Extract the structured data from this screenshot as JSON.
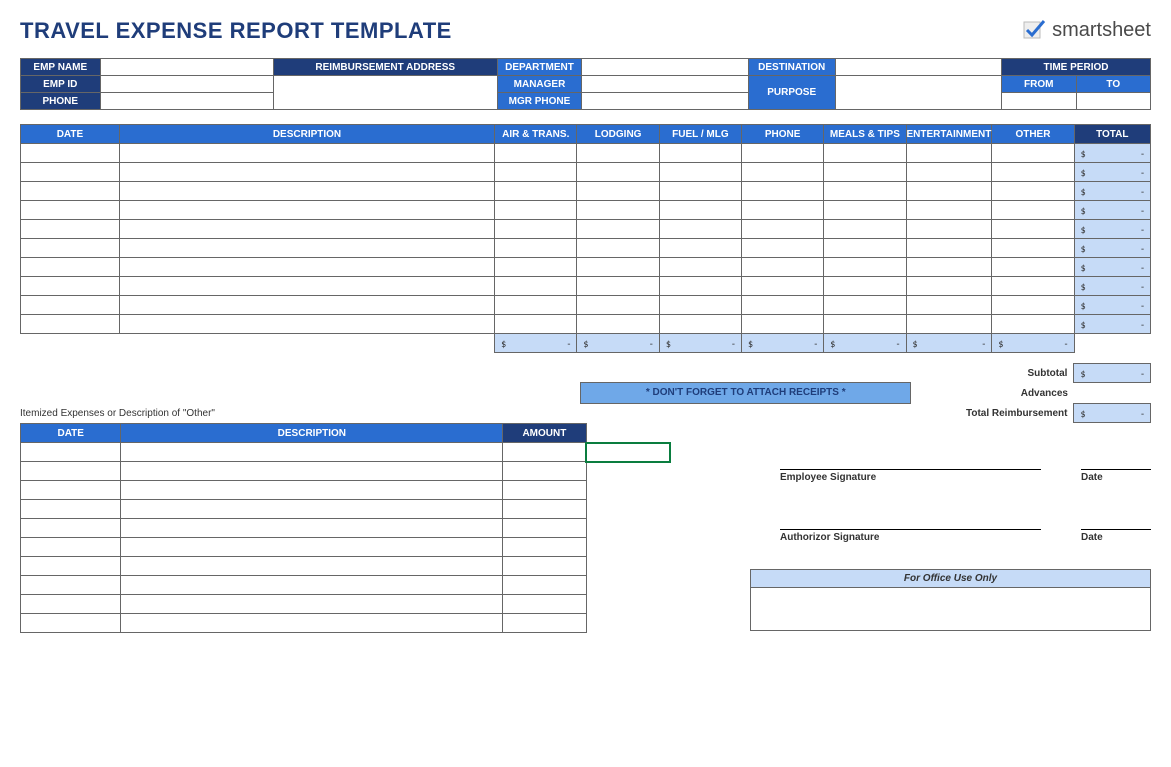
{
  "title": "TRAVEL EXPENSE REPORT TEMPLATE",
  "brand": "smartsheet",
  "info": {
    "emp_name": "EMP NAME",
    "emp_id": "EMP ID",
    "phone": "PHONE",
    "reimb_addr": "REIMBURSEMENT ADDRESS",
    "department": "DEPARTMENT",
    "manager": "MANAGER",
    "mgr_phone": "MGR PHONE",
    "destination": "DESTINATION",
    "purpose": "PURPOSE",
    "time_period": "TIME PERIOD",
    "from": "FROM",
    "to": "TO"
  },
  "expense_headers": {
    "date": "DATE",
    "description": "DESCRIPTION",
    "air_trans": "AIR & TRANS.",
    "lodging": "LODGING",
    "fuel_mlg": "FUEL / MLG",
    "phone": "PHONE",
    "meals_tips": "MEALS & TIPS",
    "entertainment": "ENTERTAINMENT",
    "other": "OTHER",
    "total": "TOTAL"
  },
  "total_placeholder": {
    "sym": "$",
    "dash": "-"
  },
  "reminder": "* DON'T FORGET TO ATTACH RECEIPTS *",
  "summary": {
    "subtotal": "Subtotal",
    "advances": "Advances",
    "total_reimb": "Total Reimbursement"
  },
  "itemized_note": "Itemized Expenses or Description of \"Other\"",
  "itemized_headers": {
    "date": "DATE",
    "description": "DESCRIPTION",
    "amount": "AMOUNT"
  },
  "signatures": {
    "employee": "Employee Signature",
    "authorizor": "Authorizor Signature",
    "date": "Date"
  },
  "office_use": "For Office Use Only"
}
